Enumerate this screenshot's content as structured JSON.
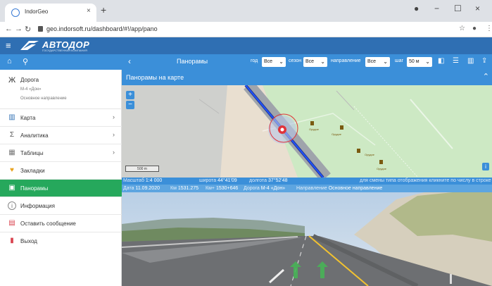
{
  "browser": {
    "tab_title": "IndorGeo",
    "tab_close": "×",
    "new_tab": "+",
    "url": "geo.indorsoft.ru/dashboard/#!/app/pano",
    "win_min": "−",
    "win_max": "☐",
    "win_close": "×"
  },
  "app": {
    "logo_text": "АВТОДОР",
    "logo_subtitle": "ГОСУДАРСТВЕННАЯ КОМПАНИЯ"
  },
  "toolbar": {
    "title": "Панорамы",
    "road_label": "год",
    "year_value": "Все",
    "season_label": "сезон",
    "season_value": "Все",
    "direction_label": "направление",
    "direction_value": "Все",
    "step_label": "шаг",
    "step_value": "50 м"
  },
  "sidebar": {
    "road": {
      "label": "Дорога",
      "name": "М-4 «Дон»",
      "direction": "Основное направление"
    },
    "items": [
      {
        "label": "Карта",
        "chevron": "›"
      },
      {
        "label": "Аналитика",
        "chevron": "›"
      },
      {
        "label": "Таблицы",
        "chevron": "›"
      },
      {
        "label": "Закладки"
      },
      {
        "label": "Панорамы"
      },
      {
        "label": "Информация"
      },
      {
        "label": "Оставить сообщение"
      },
      {
        "label": "Выход"
      }
    ]
  },
  "map_panel": {
    "title": "Панорамы на карте",
    "zoom_in": "+",
    "zoom_out": "−",
    "scale_bar": "500 m",
    "info": "i",
    "map_labels": [
      "Орудие",
      "Орудие",
      "Орудие",
      "Орудие"
    ]
  },
  "status": {
    "scale_label": "Масштаб",
    "scale_value": "1:4 000",
    "lat_label": "широта",
    "lat_value": "44°41'09",
    "lon_label": "долгота",
    "lon_value": "37°52'48",
    "hint": "для смены типа отображения кликните по числу в строке",
    "date_label": "Дата",
    "date_value": "11.09.2020",
    "km_label": "Км",
    "km_value": "1531.275",
    "km2_label": "Км+",
    "km2_value": "1530+646",
    "road_label": "Дорога",
    "road_value": "М-4 «Дон»",
    "dir_label": "Направление",
    "dir_value": "Основное направление"
  },
  "colors": {
    "header": "#2f6fb3",
    "toolbar": "#3b8fd9",
    "active": "#26a85c"
  }
}
